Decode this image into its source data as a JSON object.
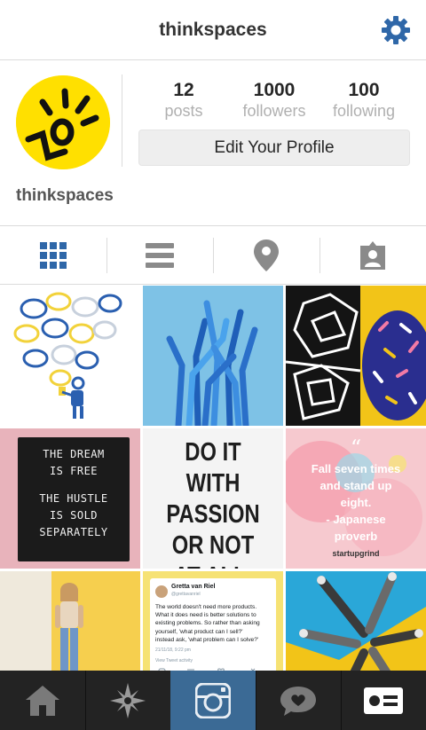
{
  "header": {
    "title": "thinkspaces",
    "settings_icon": "gear-icon"
  },
  "profile": {
    "username": "thinkspaces",
    "stats": [
      {
        "value": "12",
        "label": "posts"
      },
      {
        "value": "1000",
        "label": "followers"
      },
      {
        "value": "100",
        "label": "following"
      }
    ],
    "edit_button": "Edit Your Profile"
  },
  "view_tabs": [
    "grid-icon",
    "list-icon",
    "location-pin-icon",
    "tagged-photos-icon"
  ],
  "posts": {
    "p5": {
      "lines": [
        "DO IT WITH",
        "PASSION",
        "OR NOT",
        "AT ALL."
      ]
    },
    "p4": {
      "lines": [
        "THE DREAM",
        "IS FREE",
        "THE HUSTLE",
        "IS SOLD",
        "SEPARATELY"
      ]
    },
    "p6": {
      "quote_mark": "“",
      "lines": [
        "Fall seven times",
        "and stand up",
        "eight.",
        "- Japanese",
        "proverb"
      ],
      "brand": "startupgrind"
    },
    "p8": {
      "author": "Gretta van Riel",
      "handle": "@grettavanriel",
      "text": [
        "The world doesn't need more products.",
        "What it does need is better solutions to",
        "existing problems. So rather than asking",
        "yourself, 'what product can I sell?'",
        "instead ask, 'what problem can I solve?'"
      ],
      "time": "21/11/18, 9:22 pm",
      "activity": "View Tweet activity"
    }
  },
  "bottom_nav": [
    "home-icon",
    "explore-icon",
    "camera-icon",
    "activity-icon",
    "profile-card-icon"
  ],
  "colors": {
    "accent": "#3b6a95",
    "nav_bg": "#232323",
    "avatar_yellow": "#ffe000"
  }
}
